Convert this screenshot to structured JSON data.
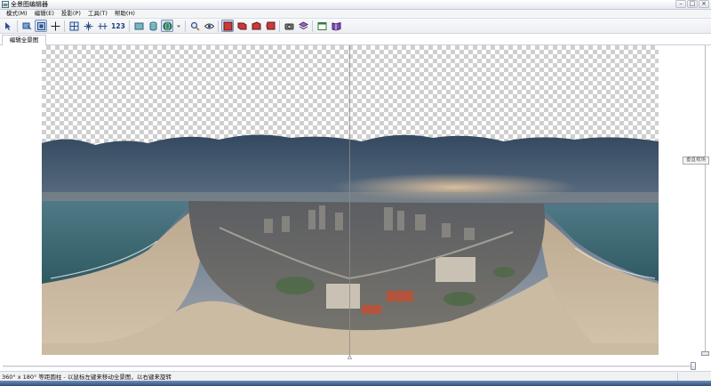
{
  "window": {
    "title": "全景图编辑器",
    "controls": [
      "minimize",
      "maximize",
      "close"
    ]
  },
  "menu": [
    {
      "label": "模式(M)"
    },
    {
      "label": "编辑(E)"
    },
    {
      "label": "投影(P)"
    },
    {
      "label": "工具(T)"
    },
    {
      "label": "帮助(H)"
    }
  ],
  "toolbar": {
    "groups": [
      [
        "select-tool-icon",
        "preview-tool-icon",
        "move-tool-icon",
        "crosshair-icon"
      ],
      [
        "grid-icon",
        "center-icon",
        "horizontal-align-icon"
      ],
      [
        "numbers"
      ],
      [
        "flat-projection-icon",
        "cylinder-projection-icon",
        "sphere-projection-icon",
        "dropdown-arrow-icon"
      ],
      [
        "zoom-icon",
        "eye-icon"
      ],
      [
        "cube-face-1-icon",
        "cube-face-2-icon",
        "cube-face-3-icon",
        "cube-face-4-icon"
      ],
      [
        "camera-icon",
        "layers-icon"
      ],
      [
        "window-icon",
        "book-icon"
      ]
    ],
    "numbers_label": "123",
    "active": "sphere-projection-icon"
  },
  "tab": {
    "label": "编辑全景图"
  },
  "vertical_slider": {
    "label": "垂直视场"
  },
  "status": {
    "text": "360° x 180° 等距圆柱 - 以鼠标左键来移动全景图，以右键来旋转"
  },
  "colors": {
    "sky_top": "#3c556f",
    "sky_mid": "#6f8196",
    "sunset": "#c9a98a",
    "sea": "#3f6b78",
    "sand": "#c8b59d",
    "city": "#6a6a66"
  }
}
